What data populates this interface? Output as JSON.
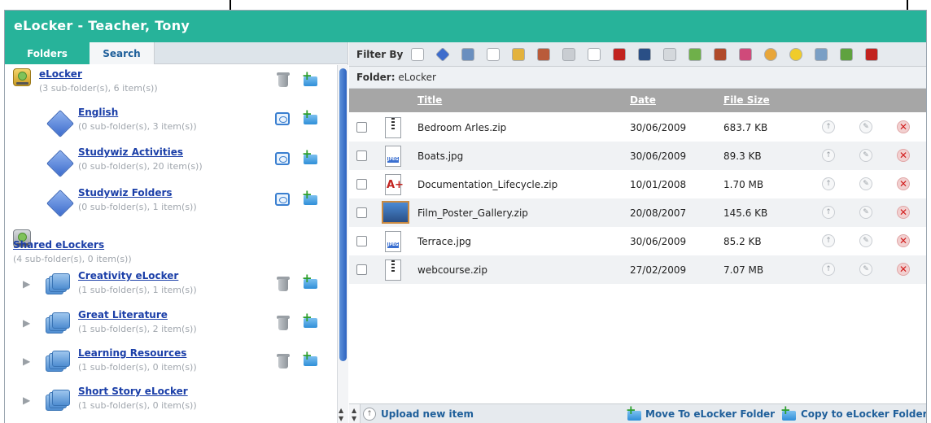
{
  "window": {
    "title": "eLocker - Teacher, Tony"
  },
  "tabs": [
    {
      "label": "Folders"
    },
    {
      "label": "Search"
    }
  ],
  "tree": {
    "nodes": [
      {
        "title": "eLocker",
        "sub": "(3 sub-folder(s), 6 item(s))",
        "icon": "elocker-drive-icon"
      },
      {
        "title": "English",
        "sub": "(0 sub-folder(s), 3 item(s))",
        "icon": "blue-diamond-folder-icon"
      },
      {
        "title": "Studywiz Activities",
        "sub": "(0 sub-folder(s), 20 item(s))",
        "icon": "blue-diamond-folder-icon"
      },
      {
        "title": "Studywiz Folders",
        "sub": "(0 sub-folder(s), 1 item(s))",
        "icon": "blue-diamond-folder-icon"
      },
      {
        "title": "Shared eLockers",
        "sub": "(4 sub-folder(s), 0 item(s))",
        "icon": "shared-drive-icon"
      },
      {
        "title": "Creativity eLocker",
        "sub": "(1 sub-folder(s), 1 item(s))",
        "icon": "stacked-folders-icon"
      },
      {
        "title": "Great Literature",
        "sub": "(1 sub-folder(s), 2 item(s))",
        "icon": "stacked-folders-icon"
      },
      {
        "title": "Learning Resources",
        "sub": "(1 sub-folder(s), 0 item(s))",
        "icon": "stacked-folders-icon"
      },
      {
        "title": "Short Story eLocker",
        "sub": "(1 sub-folder(s), 0 item(s))",
        "icon": "stacked-folders-icon"
      }
    ]
  },
  "filter": {
    "label": "Filter By",
    "icons": [
      "blank-document-icon",
      "blue-diamond-icon",
      "disk-icon",
      "text-document-icon",
      "colour-grid-icon",
      "pencil-document-icon",
      "draw-icon",
      "plain-page-icon",
      "calendar-27-icon",
      "slide-icon",
      "bubbles-icon",
      "checklist-icon",
      "basket-icon",
      "pen-icon",
      "inbox-icon",
      "smiley-icon",
      "note-icon",
      "monitor-icon",
      "pdf-icon"
    ]
  },
  "folder": {
    "label": "Folder:",
    "name": "eLocker"
  },
  "table": {
    "headers": {
      "title": "Title",
      "date": "Date",
      "size": "File Size"
    },
    "rows": [
      {
        "name": "Bedroom Arles.zip",
        "date": "30/06/2009",
        "size": "683.7 KB",
        "type": "zip"
      },
      {
        "name": "Boats.jpg",
        "date": "30/06/2009",
        "size": "89.3 KB",
        "type": "jpg"
      },
      {
        "name": "Documentation_Lifecycle.zip",
        "date": "10/01/2008",
        "size": "1.70 MB",
        "type": "pdf"
      },
      {
        "name": "Film_Poster_Gallery.zip",
        "date": "20/08/2007",
        "size": "145.6 KB",
        "type": "poster"
      },
      {
        "name": "Terrace.jpg",
        "date": "30/06/2009",
        "size": "85.2 KB",
        "type": "jpg"
      },
      {
        "name": "webcourse.zip",
        "date": "27/02/2009",
        "size": "7.07 MB",
        "type": "zip"
      }
    ]
  },
  "footer": {
    "upload_label": "Upload new item",
    "move_label": "Move To eLocker Folder",
    "copy_label": "Copy to eLocker Folder"
  }
}
